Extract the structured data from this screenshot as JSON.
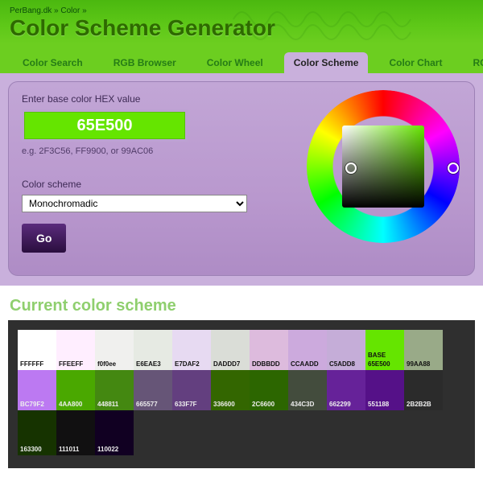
{
  "crumbs": {
    "site": "PerBang.dk",
    "sep1": "»",
    "section": "Color",
    "sep2": "»"
  },
  "title": "Color Scheme Generator",
  "tabs": [
    {
      "label": "Color Search"
    },
    {
      "label": "RGB Browser"
    },
    {
      "label": "Color Wheel"
    },
    {
      "label": "Color Scheme"
    },
    {
      "label": "Color Chart"
    },
    {
      "label": "RGB Gr"
    }
  ],
  "active_tab_index": 3,
  "panel": {
    "hex_label": "Enter base color HEX value",
    "hex_value": "65E500",
    "hex_hint": "e.g. 2F3C56, FF9900, or 99AC06",
    "scheme_label": "Color scheme",
    "scheme_value": "Monochromadic",
    "go_label": "Go"
  },
  "scheme_heading": "Current color scheme",
  "base_tag": "BASE",
  "swatches": {
    "row1": [
      {
        "hex": "FFFFFF",
        "bg": "#FFFFFF",
        "dark": false
      },
      {
        "hex": "FFEEFF",
        "bg": "#FFEEFF",
        "dark": false
      },
      {
        "hex": "f0f0ee",
        "bg": "#F0F0EE",
        "dark": false
      },
      {
        "hex": "E6EAE3",
        "bg": "#E6EAE3",
        "dark": false
      },
      {
        "hex": "E7DAF2",
        "bg": "#E7DAF2",
        "dark": false
      },
      {
        "hex": "DADDD7",
        "bg": "#DADDD7",
        "dark": false
      },
      {
        "hex": "DDBBDD",
        "bg": "#DDBBDD",
        "dark": false
      },
      {
        "hex": "CCAADD",
        "bg": "#CCAADD",
        "dark": false
      },
      {
        "hex": "C5ADD8",
        "bg": "#C5ADD8",
        "dark": false
      },
      {
        "hex": "65E500",
        "bg": "#65E500",
        "dark": false,
        "base": true
      },
      {
        "hex": "99AA88",
        "bg": "#99AA88",
        "dark": false
      }
    ],
    "row2": [
      {
        "hex": "BC79F2",
        "bg": "#BC79F2",
        "dark": true
      },
      {
        "hex": "4AA800",
        "bg": "#4AA800",
        "dark": true
      },
      {
        "hex": "448811",
        "bg": "#448811",
        "dark": true
      },
      {
        "hex": "665577",
        "bg": "#665577",
        "dark": true
      },
      {
        "hex": "633F7F",
        "bg": "#633F7F",
        "dark": true
      },
      {
        "hex": "336600",
        "bg": "#336600",
        "dark": true
      },
      {
        "hex": "2C6600",
        "bg": "#2C6600",
        "dark": true
      },
      {
        "hex": "434C3D",
        "bg": "#434C3D",
        "dark": true
      },
      {
        "hex": "662299",
        "bg": "#662299",
        "dark": true
      },
      {
        "hex": "551188",
        "bg": "#551188",
        "dark": true
      },
      {
        "hex": "2B2B2B",
        "bg": "#2B2B2B",
        "dark": true
      }
    ],
    "row3": [
      {
        "hex": "163300",
        "bg": "#163300",
        "dark": true
      },
      {
        "hex": "111011",
        "bg": "#111011",
        "dark": true
      },
      {
        "hex": "110022",
        "bg": "#110022",
        "dark": true
      }
    ]
  }
}
